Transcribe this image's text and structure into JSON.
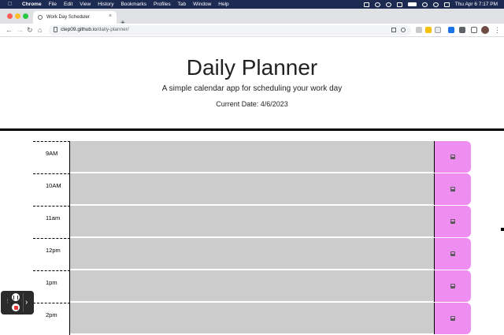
{
  "menubar": {
    "app_name": "Chrome",
    "items": [
      "File",
      "Edit",
      "View",
      "History",
      "Bookmarks",
      "Profiles",
      "Tab",
      "Window",
      "Help"
    ],
    "clock": "Thu Apr 6  7:17 PM"
  },
  "browser": {
    "tab_title": "Work Day Scheduler",
    "url_host": "ctep09.github.io",
    "url_path": "/daily-planner/"
  },
  "header": {
    "title": "Daily Planner",
    "subtitle": "A simple calendar app for scheduling your work day",
    "current_date": "Current Date: 4/6/2023"
  },
  "planner": {
    "hours": [
      "9AM",
      "10AM",
      "11am",
      "12pm",
      "1pm",
      "2pm"
    ],
    "colors": {
      "block": "#cccccc",
      "save": "#ee8ef0"
    }
  },
  "icons": {
    "save": "save-icon",
    "lock": "lock-icon"
  }
}
